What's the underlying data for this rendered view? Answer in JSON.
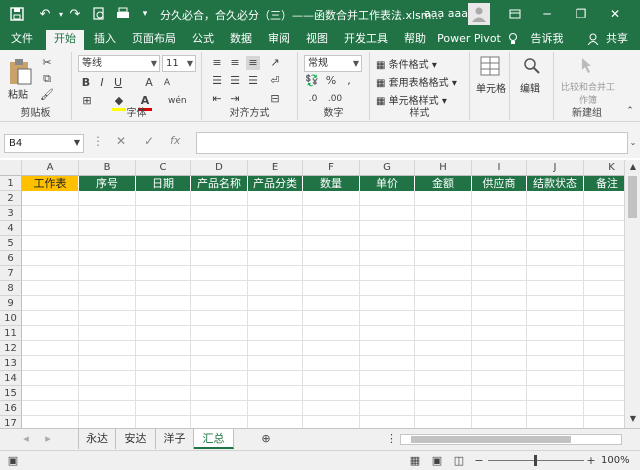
{
  "title_bar": {
    "save_icon": "save-icon",
    "undo_icon": "undo-icon",
    "redo_icon": "redo-icon",
    "print_preview_icon": "print-preview-icon",
    "quick_print_icon": "quick-print-icon",
    "customize_icon": "chevron-down-icon",
    "doc_title": "分久必合，合久必分（三）——函数合并工作表法.xlsm...",
    "user_name": "aaa aaa",
    "win_controls": [
      "ribbon-display-icon",
      "minimize-icon",
      "restore-icon",
      "close-icon"
    ]
  },
  "tabs": [
    "文件",
    "开始",
    "插入",
    "页面布局",
    "公式",
    "数据",
    "审阅",
    "视图",
    "开发工具",
    "帮助",
    "Power Pivot",
    "告诉我",
    "共享"
  ],
  "active_tab": "开始",
  "ribbon": {
    "clipboard": {
      "label": "剪贴板",
      "paste": "粘贴"
    },
    "font": {
      "label": "字体",
      "name": "等线",
      "size": "11"
    },
    "alignment": {
      "label": "对齐方式"
    },
    "number": {
      "label": "数字",
      "format": "常规"
    },
    "styles": {
      "label": "样式",
      "items": [
        "条件格式",
        "套用表格格式",
        "单元格样式"
      ]
    },
    "cells": {
      "label": "",
      "item": "单元格"
    },
    "editing": {
      "label": "",
      "item": "编辑"
    },
    "new_group": {
      "label": "新建组",
      "item": "比较和合并工作簿"
    }
  },
  "formula_bar": {
    "name_box": "B4",
    "fx": "fx",
    "value": ""
  },
  "columns": [
    "A",
    "B",
    "C",
    "D",
    "E",
    "F",
    "G",
    "H",
    "I",
    "J",
    "K"
  ],
  "rows": [
    "1",
    "2",
    "3",
    "4",
    "5",
    "6",
    "7",
    "8",
    "9",
    "10",
    "11",
    "12",
    "13",
    "14",
    "15",
    "16",
    "17"
  ],
  "header_row": [
    "工作表",
    "序号",
    "日期",
    "产品名称",
    "产品分类",
    "数量",
    "单价",
    "金额",
    "供应商",
    "结款状态",
    "备注"
  ],
  "colors": {
    "excel_green": "#217346",
    "header_yellow": "#ffc000",
    "header_green": "#217346"
  },
  "sheet_tabs": [
    "永达",
    "安达",
    "洋子",
    "汇总"
  ],
  "active_sheet": "汇总",
  "status": {
    "zoom": "100%"
  }
}
